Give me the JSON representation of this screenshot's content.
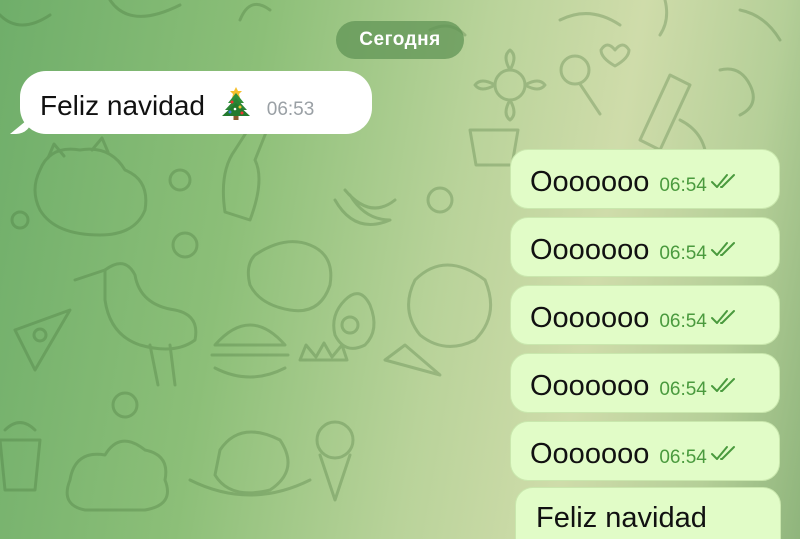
{
  "date_separator": "Сегодня",
  "messages": [
    {
      "direction": "in",
      "text": "Feliz navidad",
      "emoji": "christmas-tree",
      "time": "06:53"
    },
    {
      "direction": "out",
      "text": "Ooooooo",
      "time": "06:54",
      "status": "read"
    },
    {
      "direction": "out",
      "text": "Ooooooo",
      "time": "06:54",
      "status": "read"
    },
    {
      "direction": "out",
      "text": "Ooooooo",
      "time": "06:54",
      "status": "read"
    },
    {
      "direction": "out",
      "text": "Ooooooo",
      "time": "06:54",
      "status": "read"
    },
    {
      "direction": "out",
      "text": "Ooooooo",
      "time": "06:54",
      "status": "read"
    },
    {
      "direction": "out",
      "text": "Feliz navidad"
    }
  ],
  "colors": {
    "incoming_bubble": "#ffffff",
    "outgoing_bubble": "#e1fcc7",
    "outgoing_time": "#4a9a3e",
    "date_pill": "#609456"
  }
}
